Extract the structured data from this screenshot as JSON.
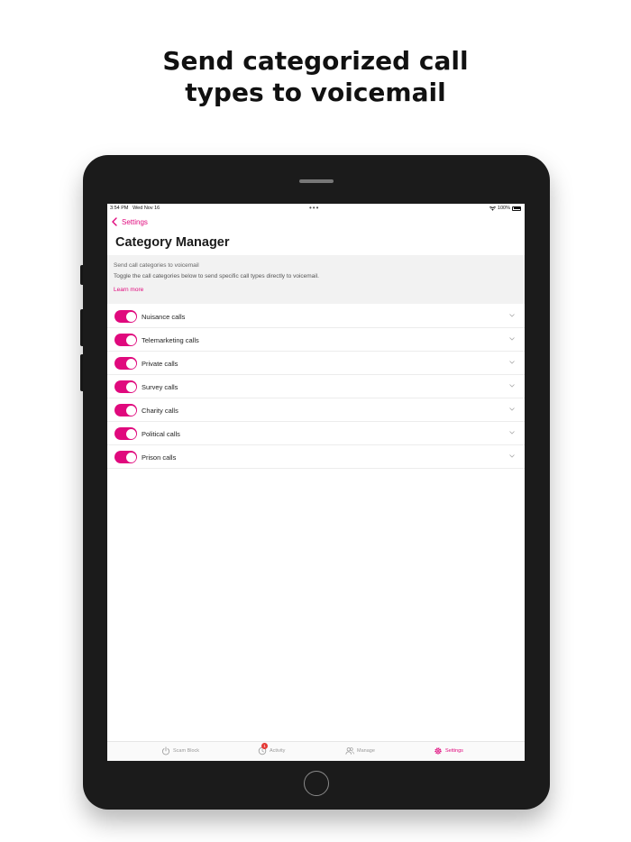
{
  "headline": {
    "line1": "Send categorized call",
    "line2": "types to voicemail"
  },
  "statusbar": {
    "time": "3:54 PM",
    "date": "Wed Nov 16",
    "battery": "100%"
  },
  "nav": {
    "back_label": "Settings"
  },
  "page_title": "Category Manager",
  "info": {
    "line1": "Send call categories to voicemail",
    "line2": "Toggle the call categories below to send specific call types directly to voicemail.",
    "link": "Learn more"
  },
  "categories": [
    {
      "label": "Nuisance calls",
      "enabled": true
    },
    {
      "label": "Telemarketing calls",
      "enabled": true
    },
    {
      "label": "Private calls",
      "enabled": true
    },
    {
      "label": "Survey calls",
      "enabled": true
    },
    {
      "label": "Charity calls",
      "enabled": true
    },
    {
      "label": "Political calls",
      "enabled": true
    },
    {
      "label": "Prison calls",
      "enabled": true
    }
  ],
  "tabs": [
    {
      "label": "Scam Block",
      "icon": "power-icon",
      "active": false
    },
    {
      "label": "Activity",
      "icon": "activity-icon",
      "active": false,
      "badge": "1"
    },
    {
      "label": "Manage",
      "icon": "people-icon",
      "active": false
    },
    {
      "label": "Settings",
      "icon": "gear-icon",
      "active": true
    }
  ],
  "colors": {
    "accent": "#e0097d",
    "badge": "#e53935",
    "device": "#1b1b1b"
  }
}
